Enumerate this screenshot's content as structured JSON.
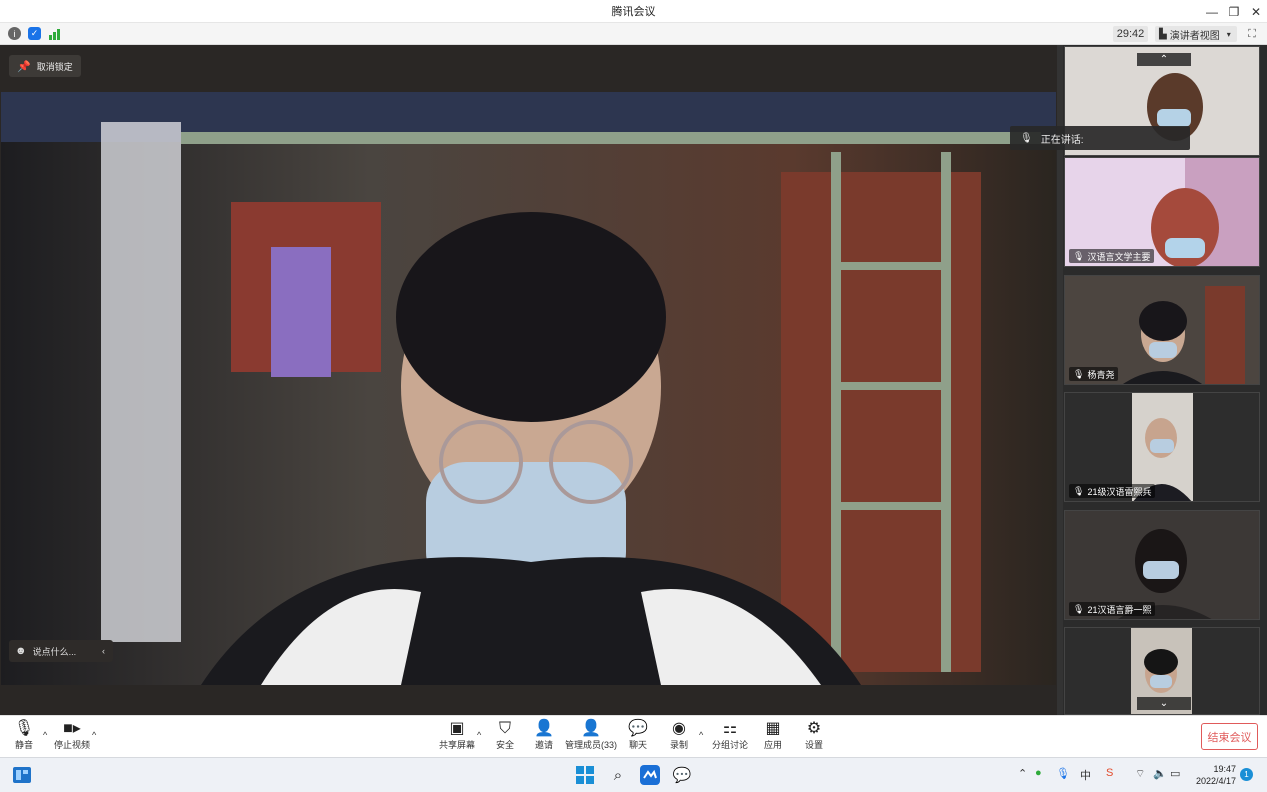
{
  "window": {
    "title": "腾讯会议"
  },
  "infobar": {
    "timer": "29:42",
    "view_label": "演讲者视图"
  },
  "stage": {
    "unpin_label": "取消锁定",
    "chat_placeholder": "说点什么...",
    "speaking_label": "正在讲话:"
  },
  "participants": [
    {
      "name": ""
    },
    {
      "name": "汉语言文学主要"
    },
    {
      "name": "杨青尧"
    },
    {
      "name": "21级汉语雷熙兵"
    },
    {
      "name": "21汉语言爵一熙"
    },
    {
      "name": ""
    }
  ],
  "toolbar": {
    "mute": "静音",
    "stop_video": "停止视频",
    "share": "共享屏幕",
    "security": "安全",
    "invite": "邀请",
    "members": "管理成员(33)",
    "chat": "聊天",
    "record": "录制",
    "breakout": "分组讨论",
    "apps": "应用",
    "settings": "设置",
    "end": "结束会议"
  },
  "taskbar": {
    "time": "19:47",
    "date": "2022/4/17",
    "ime": "中",
    "notifications": "1"
  },
  "colors": {
    "end_red": "#e05a5a",
    "accent_blue": "#1a8fd6"
  }
}
